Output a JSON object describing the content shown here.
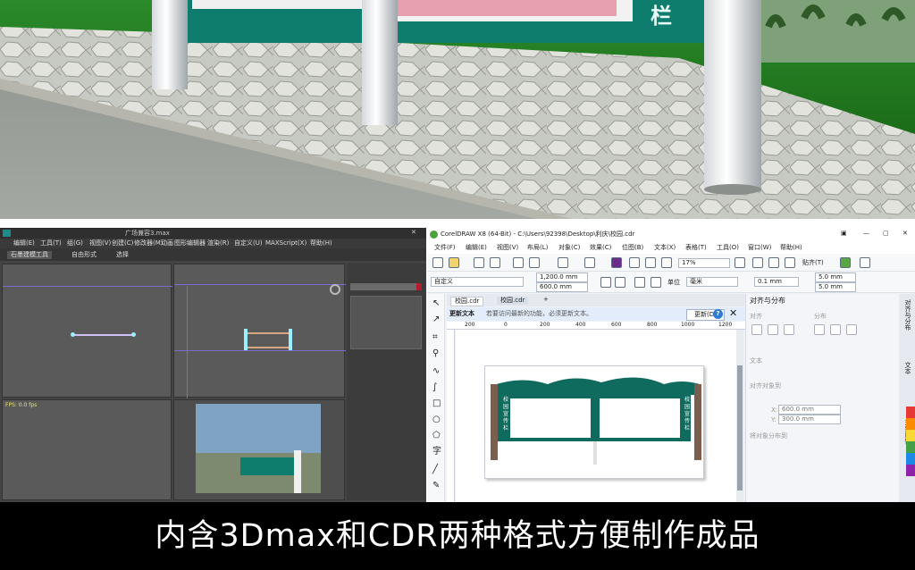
{
  "banner": {
    "text": "内含3Dmax和CDR两种格式方便制作成品"
  },
  "scene": {
    "sign_text": "栏"
  },
  "max_window": {
    "title": "广场兼容3.max",
    "menu": [
      "编辑(E)",
      "工具(T)",
      "组(G)",
      "视图(V)",
      "创建(C)",
      "修改器(M)",
      "动画",
      "图形编辑器",
      "渲染(R)",
      "自定义(U)",
      "MAXScript(X)",
      "帮助(H)"
    ],
    "tabs": [
      "石墨建模工具",
      "自由形式",
      "选择"
    ],
    "stats": "FPS: 0.0 fps"
  },
  "cdr": {
    "title": "CorelDRAW X8 (64-Bit) - C:\\Users\\92398\\Desktop\\利庆\\校园.cdr",
    "menu": [
      "文件(F)",
      "编辑(E)",
      "视图(V)",
      "布局(L)",
      "对象(C)",
      "效果(C)",
      "位图(B)",
      "文本(X)",
      "表格(T)",
      "工具(O)",
      "窗口(W)",
      "帮助(H)"
    ],
    "zoom": "17%",
    "snap": "贴齐(T)",
    "preset": "自定义",
    "width": "1,200.0 mm",
    "height": "600.0 mm",
    "unit_label": "单位",
    "unit": "毫米",
    "nudge": "0.1 mm",
    "dup_x": "5.0 mm",
    "dup_y": "5.0 mm",
    "tabs": [
      "校园.cdr",
      "校园.cdr"
    ],
    "notice": "更新文本",
    "notice_msg": "若要访问最新的功能，必须更新文本。",
    "update_btn": "更新(D)",
    "ruler": [
      "200",
      "0",
      "200",
      "400",
      "600",
      "800",
      "1000",
      "1200"
    ],
    "panel_title": "对齐与分布",
    "panel_align": "对齐",
    "panel_distribute": "分布",
    "panel_text": "文本",
    "panel_objects": "对齐对象到",
    "panel_x_label": "X:",
    "panel_x": "600.0 mm",
    "panel_y_label": "Y:",
    "panel_y": "300.0 mm",
    "panel_spacing": "将对象分布到",
    "side_tabs": [
      "对齐与分布",
      "文本",
      "对象属性"
    ],
    "board_left": "校园宣传栏",
    "board_right": "校园宣传栏"
  },
  "colors": {
    "board": "#0e6b5d",
    "post": "#7a5f4f",
    "accent": "#2e7bd6"
  }
}
